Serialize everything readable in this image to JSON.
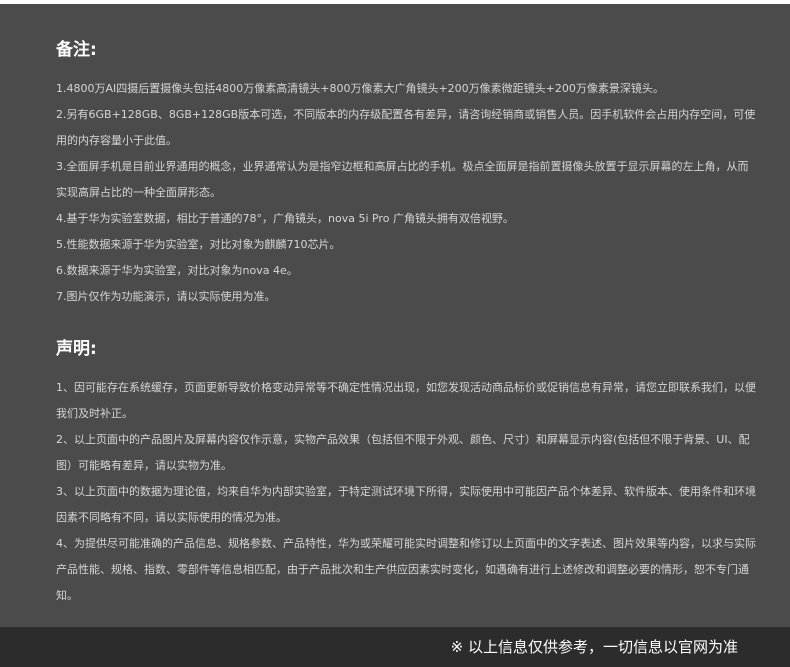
{
  "notes": {
    "heading": "备注:",
    "items": [
      "1.4800万AI四摄后置摄像头包括4800万像素高清镜头+800万像素大广角镜头+200万像素微距镜头+200万像素景深镜头。",
      "2.另有6GB+128GB、8GB+128GB版本可选，不同版本的内存级配置各有差异，请咨询经销商或销售人员。因手机软件会占用内存空间，可使用的内存容量小于此值。",
      "3.全面屏手机是目前业界通用的概念，业界通常认为是指窄边框和高屏占比的手机。极点全面屏是指前置摄像头放置于显示屏幕的左上角，从而实现高屏占比的一种全面屏形态。",
      "4.基于华为实验室数据，相比于普通的78°，广角镜头，nova 5i Pro 广角镜头拥有双倍视野。",
      "5.性能数据来源于华为实验室，对比对象为麒麟710芯片。",
      "6.数据来源于华为实验室，对比对象为nova 4e。",
      "7.图片仅作为功能演示，请以实际使用为准。"
    ]
  },
  "declaration": {
    "heading": "声明:",
    "items": [
      "1、因可能存在系统缓存，页面更新导致价格变动异常等不确定性情况出现，如您发现活动商品标价或促销信息有异常，请您立即联系我们，以便我们及时补正。",
      "2、以上页面中的产品图片及屏幕内容仅作示意，实物产品效果（包括但不限于外观、颜色、尺寸）和屏幕显示内容(包括但不限于背景、UI、配图）可能略有差异，请以实物为准。",
      "3、以上页面中的数据为理论值，均来自华为内部实验室，于特定测试环境下所得，实际使用中可能因产品个体差异、软件版本、使用条件和环境因素不同略有不同，请以实际使用的情况为准。",
      "4、为提供尽可能准确的产品信息、规格参数、产品特性，华为或荣耀可能实时调整和修订以上页面中的文字表述、图片效果等内容，以求与实际产品性能、规格、指数、零部件等信息相匹配，由于产品批次和生产供应因素实时变化，如遇确有进行上述修改和调整必要的情形，恕不专门通知。"
    ]
  },
  "footer": {
    "text": "※ 以上信息仅供参考，一切信息以官网为准"
  },
  "colors": {
    "panel_background": "#4b4b4b",
    "footer_background": "#2c2c2c",
    "heading_text": "#ffffff",
    "body_text": "#d6d6d6"
  }
}
